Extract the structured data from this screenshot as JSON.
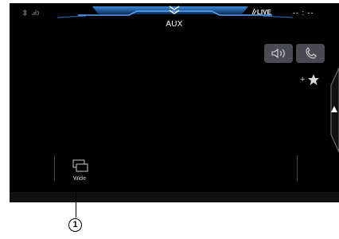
{
  "header": {
    "source_title": "AUX",
    "live_label": "LIVE",
    "clock": "-- : --",
    "status_icons": [
      "bluetooth-icon",
      "phone-signal-icon"
    ]
  },
  "buttons": {
    "volume_icon": "speaker-volume-icon",
    "phone_icon": "phone-icon",
    "favorite_label": "+★",
    "panel_toggle_icon": "chevron-up-icon"
  },
  "wide_button": {
    "label": "Wide",
    "icon": "screen-mode-icon"
  },
  "callout": {
    "number": "1"
  },
  "colors": {
    "screen_bg": "#000000",
    "accent_blue": "#2a72c8",
    "button_bg": "#4a4a52",
    "text": "#ffffff"
  }
}
